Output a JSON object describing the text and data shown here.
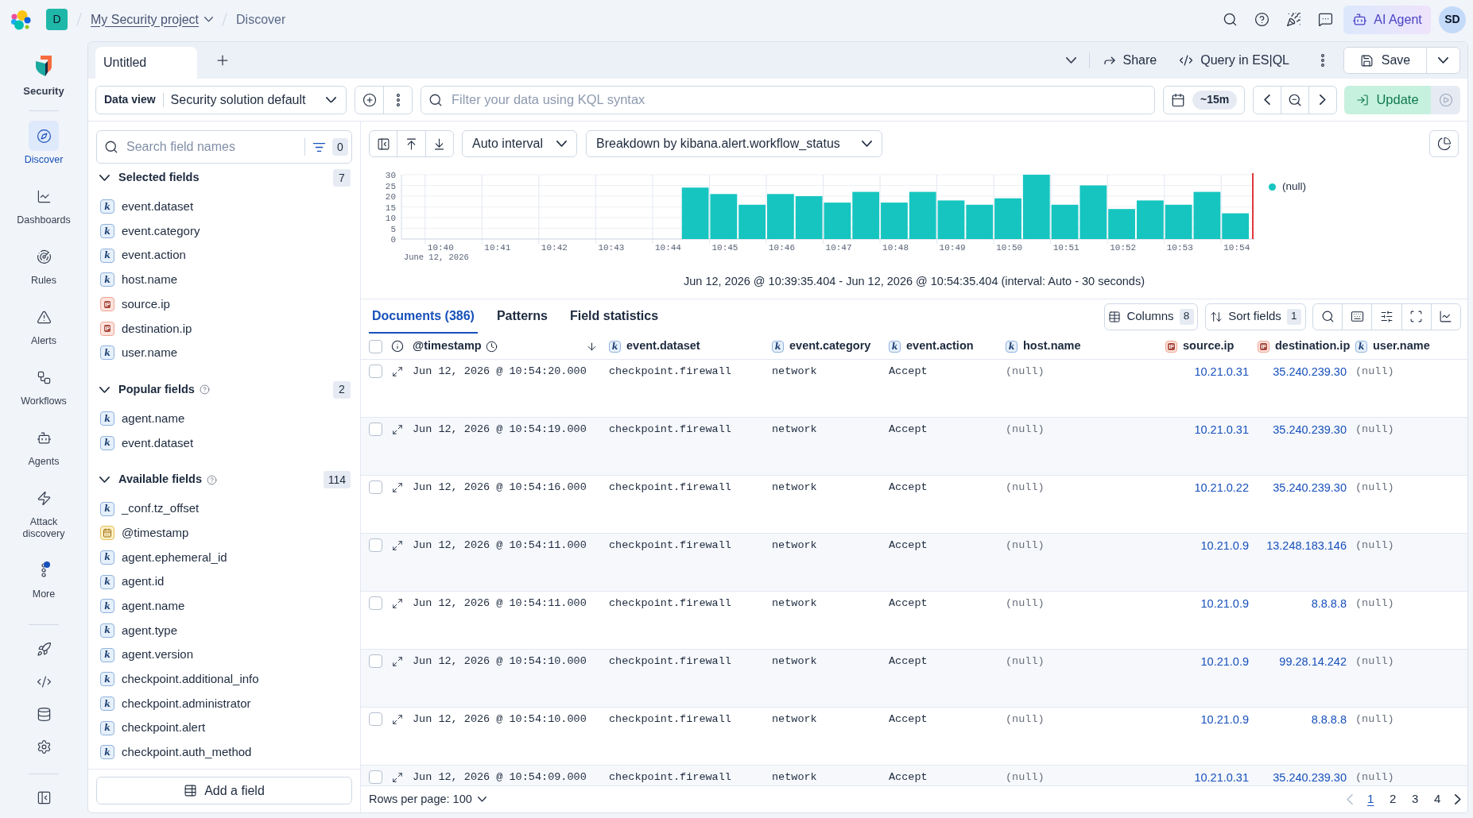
{
  "header": {
    "space_badge": "D",
    "breadcrumbs": [
      {
        "label": "My Security project",
        "kind": "link"
      },
      {
        "label": "Discover",
        "kind": "current"
      }
    ],
    "ai_agent_button": "AI Agent",
    "avatar": "SD"
  },
  "nav": {
    "title": "Security",
    "items": [
      {
        "label": "Discover",
        "selected": true,
        "notification": false
      },
      {
        "label": "Dashboards",
        "selected": false,
        "notification": false
      },
      {
        "label": "Rules",
        "selected": false,
        "notification": false
      },
      {
        "label": "Alerts",
        "selected": false,
        "notification": false
      },
      {
        "label": "Workflows",
        "selected": false,
        "notification": false
      },
      {
        "label": "Agents",
        "selected": false,
        "notification": false
      },
      {
        "label": "Attack discovery",
        "selected": false,
        "notification": false
      },
      {
        "label": "More",
        "selected": false,
        "notification": true
      }
    ]
  },
  "tab_bar": {
    "tabs": [
      {
        "label": "Untitled",
        "selected": true
      }
    ],
    "share_button": "Share",
    "esql_button": "Query in ES|QL",
    "save_button": "Save"
  },
  "query_bar": {
    "data_view": {
      "label": "Data view",
      "value": "Security solution default"
    },
    "filter": {
      "placeholder": "Filter your data using KQL syntax"
    },
    "time_badge": "~15m",
    "update_button": "Update"
  },
  "sidebar": {
    "search": {
      "placeholder": "Search field names",
      "filter_count": "0"
    },
    "groups": [
      {
        "title": "Selected fields",
        "count": "7",
        "expanded": true,
        "info": false,
        "fields": [
          {
            "name": "event.dataset",
            "kind": "keyword",
            "token": "k"
          },
          {
            "name": "event.category",
            "kind": "keyword",
            "token": "k"
          },
          {
            "name": "event.action",
            "kind": "keyword",
            "token": "k"
          },
          {
            "name": "host.name",
            "kind": "keyword",
            "token": "k"
          },
          {
            "name": "source.ip",
            "kind": "ip",
            "token": "IP"
          },
          {
            "name": "destination.ip",
            "kind": "ip",
            "token": "IP"
          },
          {
            "name": "user.name",
            "kind": "keyword",
            "token": "k"
          }
        ]
      },
      {
        "title": "Popular fields",
        "count": "2",
        "expanded": true,
        "info": true,
        "fields": [
          {
            "name": "agent.name",
            "kind": "keyword",
            "token": "k"
          },
          {
            "name": "event.dataset",
            "kind": "keyword",
            "token": "k"
          }
        ]
      },
      {
        "title": "Available fields",
        "count": "114",
        "expanded": true,
        "info": true,
        "fields": [
          {
            "name": "_conf.tz_offset",
            "kind": "keyword",
            "token": "k"
          },
          {
            "name": "@timestamp",
            "kind": "date"
          },
          {
            "name": "agent.ephemeral_id",
            "kind": "keyword",
            "token": "k"
          },
          {
            "name": "agent.id",
            "kind": "keyword",
            "token": "k"
          },
          {
            "name": "agent.name",
            "kind": "keyword",
            "token": "k"
          },
          {
            "name": "agent.type",
            "kind": "keyword",
            "token": "k"
          },
          {
            "name": "agent.version",
            "kind": "keyword",
            "token": "k"
          },
          {
            "name": "checkpoint.additional_info",
            "kind": "keyword",
            "token": "k"
          },
          {
            "name": "checkpoint.administrator",
            "kind": "keyword",
            "token": "k"
          },
          {
            "name": "checkpoint.alert",
            "kind": "keyword",
            "token": "k"
          },
          {
            "name": "checkpoint.auth_method",
            "kind": "keyword",
            "token": "k"
          }
        ]
      }
    ],
    "add_button": "Add a field"
  },
  "chart": {
    "interval": "Auto interval",
    "breakdown": "Breakdown by kibana.alert.workflow_status",
    "chart_data": {
      "type": "bar",
      "categories": [
        null,
        "10:40",
        null,
        "10:41",
        null,
        "10:42",
        null,
        "10:43",
        null,
        "10:44",
        null,
        "10:45",
        null,
        "10:46",
        null,
        "10:47",
        null,
        "10:48",
        null,
        "10:49",
        null,
        "10:50",
        null,
        "10:51",
        null,
        "10:52",
        null,
        "10:53",
        null,
        "10:54"
      ],
      "series": [
        {
          "name": "(null)",
          "color": "#16c5c0",
          "values": [
            0,
            0,
            0,
            0,
            0,
            0,
            0,
            0,
            0,
            0,
            24,
            21,
            16,
            21,
            20,
            17,
            22,
            17,
            22,
            18,
            16,
            19,
            30,
            16,
            25,
            14,
            18,
            16,
            22,
            12
          ]
        }
      ],
      "ylim": [
        0,
        30
      ],
      "yticks": [
        0,
        5,
        10,
        15,
        20,
        25,
        30
      ],
      "grid": true
    },
    "date_label": "June 12, 2026",
    "caption": "Jun 12, 2026 @ 10:39:35.404 - Jun 12, 2026 @ 10:54:35.404 (interval: Auto - 30 seconds)"
  },
  "documents": {
    "tabs": [
      {
        "label": "Documents (386)",
        "selected": true
      },
      {
        "label": "Patterns",
        "selected": false
      },
      {
        "label": "Field statistics",
        "selected": false
      }
    ],
    "columns_button": {
      "label": "Columns",
      "count": "8"
    },
    "sort_button": {
      "label": "Sort fields",
      "count": "1"
    },
    "table": {
      "header_checkbox": {
        "checked": false
      },
      "columns": [
        {
          "label": "@timestamp",
          "kind": "date",
          "sorted": true,
          "missing_values": false
        },
        {
          "label": "event.dataset",
          "kind": "keyword",
          "token": "k",
          "sorted": false,
          "missing_values": false
        },
        {
          "label": "event.category",
          "kind": "keyword",
          "token": "k",
          "sorted": false,
          "missing_values": false
        },
        {
          "label": "event.action",
          "kind": "keyword",
          "token": "k",
          "sorted": false,
          "missing_values": false
        },
        {
          "label": "host.name",
          "kind": "keyword",
          "token": "k",
          "sorted": false,
          "missing_values": true
        },
        {
          "label": "source.ip",
          "kind": "ip",
          "token": "IP",
          "sorted": false,
          "missing_values": false
        },
        {
          "label": "destination.ip",
          "kind": "ip",
          "token": "IP",
          "sorted": false,
          "missing_values": false
        },
        {
          "label": "user.name",
          "kind": "keyword",
          "token": "k",
          "sorted": false,
          "missing_values": true
        }
      ],
      "rows": [
        {
          "checked": false,
          "cells": [
            "Jun 12, 2026 @ 10:54:20.000",
            "checkpoint.firewall",
            "network",
            "Accept",
            "(null)",
            "10.21.0.31",
            "35.240.239.30",
            "(null)"
          ]
        },
        {
          "checked": false,
          "cells": [
            "Jun 12, 2026 @ 10:54:19.000",
            "checkpoint.firewall",
            "network",
            "Accept",
            "(null)",
            "10.21.0.31",
            "35.240.239.30",
            "(null)"
          ]
        },
        {
          "checked": false,
          "cells": [
            "Jun 12, 2026 @ 10:54:16.000",
            "checkpoint.firewall",
            "network",
            "Accept",
            "(null)",
            "10.21.0.22",
            "35.240.239.30",
            "(null)"
          ]
        },
        {
          "checked": false,
          "cells": [
            "Jun 12, 2026 @ 10:54:11.000",
            "checkpoint.firewall",
            "network",
            "Accept",
            "(null)",
            "10.21.0.9",
            "13.248.183.146",
            "(null)"
          ]
        },
        {
          "checked": false,
          "cells": [
            "Jun 12, 2026 @ 10:54:11.000",
            "checkpoint.firewall",
            "network",
            "Accept",
            "(null)",
            "10.21.0.9",
            "8.8.8.8",
            "(null)"
          ]
        },
        {
          "checked": false,
          "cells": [
            "Jun 12, 2026 @ 10:54:10.000",
            "checkpoint.firewall",
            "network",
            "Accept",
            "(null)",
            "10.21.0.9",
            "99.28.14.242",
            "(null)"
          ]
        },
        {
          "checked": false,
          "cells": [
            "Jun 12, 2026 @ 10:54:10.000",
            "checkpoint.firewall",
            "network",
            "Accept",
            "(null)",
            "10.21.0.9",
            "8.8.8.8",
            "(null)"
          ]
        },
        {
          "checked": false,
          "cells": [
            "Jun 12, 2026 @ 10:54:09.000",
            "checkpoint.firewall",
            "network",
            "Accept",
            "(null)",
            "10.21.0.31",
            "35.240.239.30",
            "(null)"
          ]
        }
      ]
    },
    "footer": {
      "rows_per_page": "Rows per page: 100",
      "previous_disabled": true,
      "next_disabled": false,
      "pages": [
        {
          "label": "1",
          "selected": true
        },
        {
          "label": "2",
          "selected": false
        },
        {
          "label": "3",
          "selected": false
        },
        {
          "label": "4",
          "selected": false
        }
      ]
    }
  }
}
